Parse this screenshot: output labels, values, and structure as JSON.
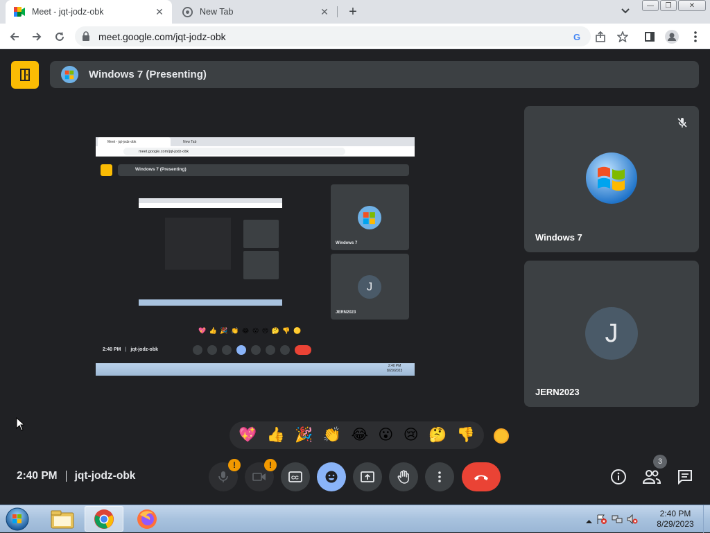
{
  "browser": {
    "tabs": [
      {
        "title": "Meet - jqt-jodz-obk",
        "active": true
      },
      {
        "title": "New Tab",
        "active": false
      }
    ],
    "url": "meet.google.com/jqt-jodz-obk"
  },
  "meet": {
    "presenting_label": "Windows 7 (Presenting)",
    "participants": [
      {
        "name": "Windows 7",
        "muted": true
      },
      {
        "name": "JERN2023",
        "initial": "J"
      }
    ],
    "reactions": [
      "💖",
      "👍",
      "🎉",
      "👏",
      "😂",
      "😮",
      "😢",
      "🤔",
      "👎"
    ],
    "time": "2:40 PM",
    "meeting_code": "jqt-jodz-obk",
    "mic_badge": "!",
    "cam_badge": "!",
    "people_count": "3",
    "colors": {
      "background": "#202124",
      "tile": "#3c4043",
      "accent": "#8ab4f8",
      "end_call": "#ea4335",
      "warning": "#f29900",
      "door": "#fbbc04"
    },
    "shared_screen": {
      "tab1": "Meet - jqt-jodz-obk",
      "tab2": "New Tab",
      "url": "meet.google.com/jqt-jodz-obk",
      "presenting_label": "Windows 7 (Presenting)",
      "tile1": "Windows 7",
      "tile2": "JERN2023",
      "initial": "J",
      "time": "2:40 PM",
      "code": "jqt-jodz-obk",
      "emojis": "💖 👍 🎉 👏 😂 😮 😢 🤔 👎 🟡",
      "clock_time": "2:40 PM",
      "clock_date": "8/29/2023"
    }
  },
  "taskbar": {
    "time": "2:40 PM",
    "date": "8/29/2023"
  }
}
